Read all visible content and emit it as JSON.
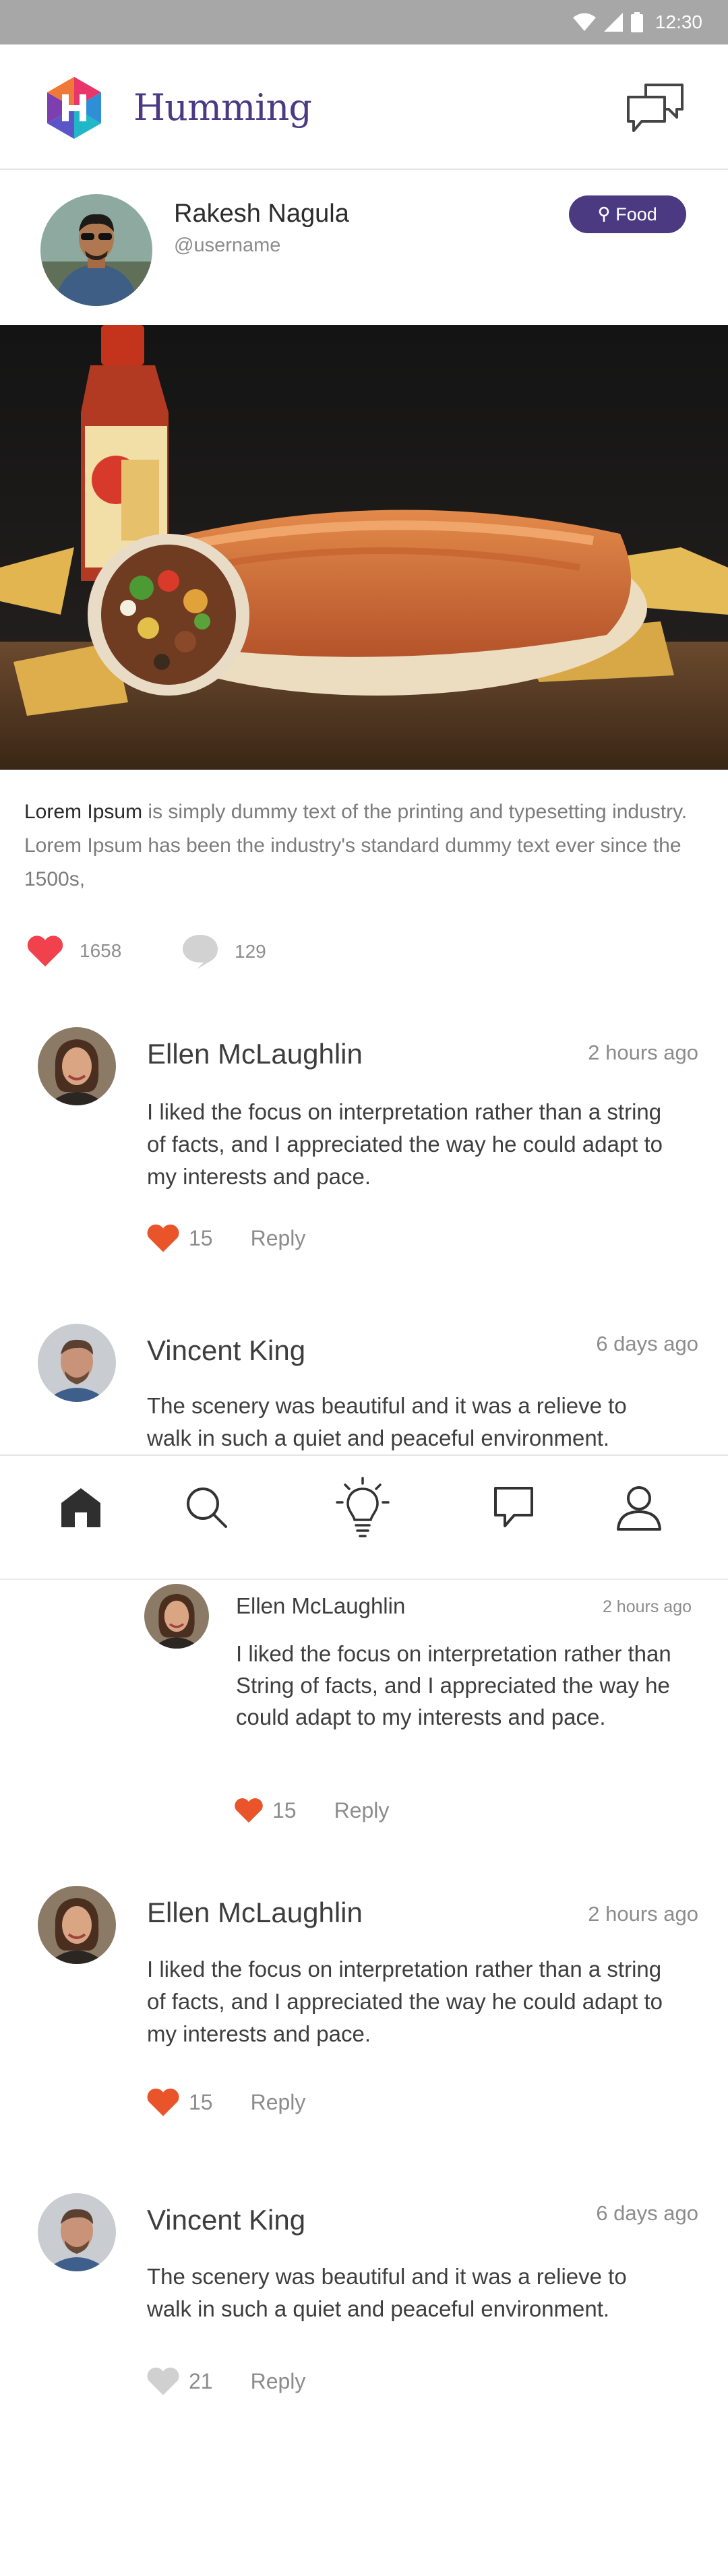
{
  "status_bar": {
    "time": "12:30"
  },
  "header": {
    "brand": "Humming"
  },
  "post": {
    "author_name": "Rakesh Nagula",
    "author_username": "@username",
    "tag": "Food",
    "caption_lead": "Lorem Ipsum",
    "caption_rest": " is simply dummy text of the printing and typesetting industry. Lorem Ipsum has been the industry's standard dummy text ever since the 1500s,",
    "likes": "1658",
    "comments": "129"
  },
  "comments": [
    {
      "name": "Ellen McLaughlin",
      "time": "2 hours ago",
      "text": "I liked the focus on interpretation rather than a string of facts, and I appreciated the way he could adapt to my interests and pace.",
      "likes": "15",
      "reply_label": "Reply"
    },
    {
      "name": "Vincent King",
      "time": "6 days ago",
      "text": "The scenery was beautiful and it was a relieve to walk in such a quiet and peaceful environment."
    },
    {
      "name": "Ellen McLaughlin",
      "time": "2 hours ago",
      "text": "I liked the focus on interpretation rather than String of facts, and I appreciated the way he could adapt to my interests and pace.",
      "likes": "15",
      "reply_label": "Reply"
    },
    {
      "name": "Ellen McLaughlin",
      "time": "2 hours ago",
      "text": "I liked the focus on interpretation rather than a string of facts, and I appreciated the way he could adapt to my interests and pace.",
      "likes": "15",
      "reply_label": "Reply"
    },
    {
      "name": "Vincent King",
      "time": "6 days ago",
      "text": "The scenery was beautiful and it was a relieve to walk in such a quiet and peaceful environment.",
      "likes": "21",
      "reply_label": "Reply"
    }
  ],
  "bottom_nav": {
    "items": [
      "home-icon",
      "search-icon",
      "lightbulb-icon",
      "chat-icon",
      "profile-icon"
    ]
  },
  "colors": {
    "brand_purple": "#4b3a82",
    "heart_red": "#f0414d",
    "heart_orange": "#e9542b",
    "muted_grey": "#d0d0d0"
  }
}
